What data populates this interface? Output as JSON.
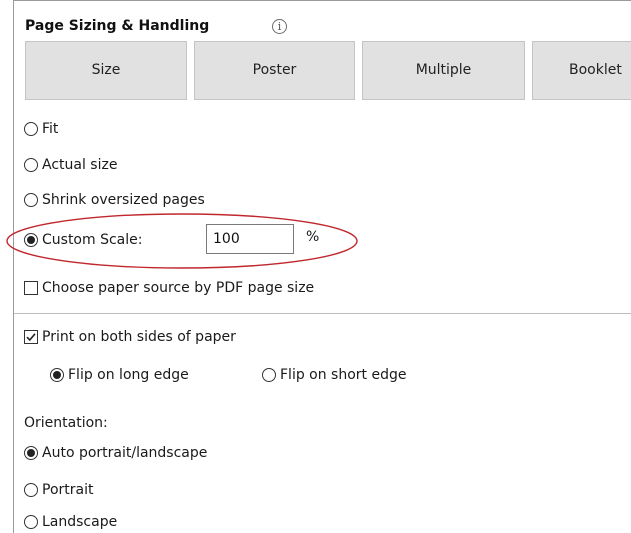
{
  "panel": {
    "title": "Page Sizing & Handling",
    "info_icon": "info-icon",
    "info_glyph": "i"
  },
  "tabs": [
    {
      "label": "Size",
      "selected": false
    },
    {
      "label": "Poster",
      "selected": false
    },
    {
      "label": "Multiple",
      "selected": false
    },
    {
      "label": "Booklet",
      "selected": false
    }
  ],
  "sizing": {
    "fit": {
      "label": "Fit",
      "selected": false
    },
    "actual": {
      "label": "Actual size",
      "selected": false
    },
    "shrink": {
      "label": "Shrink oversized pages",
      "selected": false
    },
    "custom": {
      "label": "Custom Scale:",
      "selected": true,
      "value": "100",
      "unit": "%"
    },
    "paper_source": {
      "label": "Choose paper source by PDF page size",
      "checked": false
    }
  },
  "duplex": {
    "label": "Print on both sides of paper",
    "checked": true,
    "long_edge": {
      "label": "Flip on long edge",
      "selected": true
    },
    "short_edge": {
      "label": "Flip on short edge",
      "selected": false
    }
  },
  "orientation": {
    "title": "Orientation:",
    "auto": {
      "label": "Auto portrait/landscape",
      "selected": true
    },
    "portrait": {
      "label": "Portrait",
      "selected": false
    },
    "landscape": {
      "label": "Landscape",
      "selected": false
    }
  },
  "colors": {
    "highlight_ellipse": "#c0272d",
    "tab_bg": "#e1e1e1"
  }
}
